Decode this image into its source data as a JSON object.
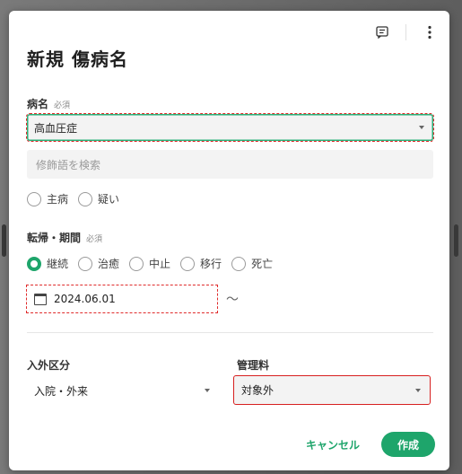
{
  "dialog": {
    "title": "新規 傷病名",
    "tools": [
      "comment-icon",
      "more-vert-icon"
    ]
  },
  "disease": {
    "label": "病名",
    "required": "必須",
    "value": "高血圧症",
    "modifier_placeholder": "修飾語を検索",
    "flags": [
      {
        "label": "主病",
        "checked": false
      },
      {
        "label": "疑い",
        "checked": false
      }
    ]
  },
  "outcome": {
    "label": "転帰・期間",
    "required": "必須",
    "options": [
      {
        "label": "継続",
        "selected": true
      },
      {
        "label": "治癒",
        "selected": false
      },
      {
        "label": "中止",
        "selected": false
      },
      {
        "label": "移行",
        "selected": false
      },
      {
        "label": "死亡",
        "selected": false
      }
    ],
    "start_date": "2024.06.01",
    "range_sep": "〜"
  },
  "inout": {
    "label": "入外区分",
    "value": "入院・外来"
  },
  "mgmt_fee": {
    "label": "管理料",
    "value": "対象外"
  },
  "actions": {
    "cancel": "キャンセル",
    "create": "作成"
  },
  "colors": {
    "accent": "#1ea56b",
    "highlight_red": "#e02b2b",
    "highlight_green": "#2ab07a"
  }
}
